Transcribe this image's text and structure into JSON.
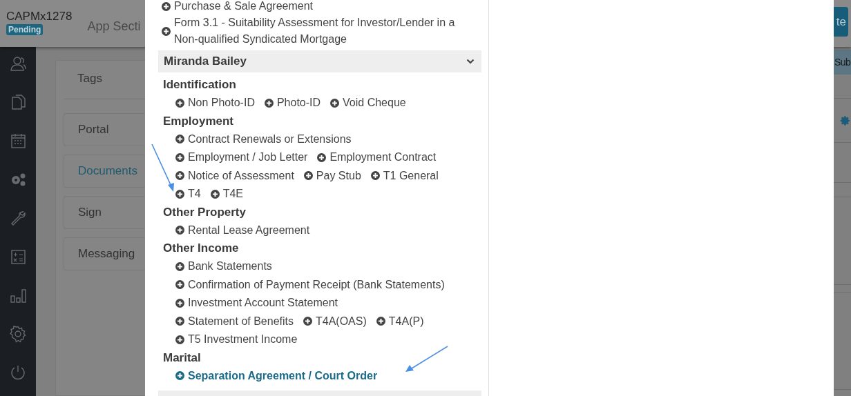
{
  "header": {
    "title": "CAPMx1278",
    "status_badge": "Pending",
    "section_label": "App Secti",
    "action_button": "te"
  },
  "tabs_panel": {
    "tab": "Tags",
    "items": [
      {
        "label": "Portal",
        "selected": false
      },
      {
        "label": "Documents",
        "selected": true
      },
      {
        "label": "Sign",
        "selected": false
      },
      {
        "label": "Messaging",
        "selected": false
      }
    ]
  },
  "right_panel": {
    "bar_label": "Sub"
  },
  "dialog": {
    "top_items": [
      {
        "label": "Purchase & Sale Agreement",
        "selected": false
      },
      {
        "label": "Form 3.1 - Suitability Assessment for Investor/Lender in a Non-qualified Syndicated Mortgage",
        "selected": false
      }
    ],
    "person": {
      "name": "Miranda Bailey",
      "expanded": true
    },
    "groups": [
      {
        "title": "Identification",
        "lines": [
          [
            {
              "label": "Non Photo-ID",
              "selected": false
            },
            {
              "label": "Photo-ID",
              "selected": false
            },
            {
              "label": "Void Cheque",
              "selected": false
            }
          ]
        ]
      },
      {
        "title": "Employment",
        "lines": [
          [
            {
              "label": "Contract Renewals or Extensions",
              "selected": false
            }
          ],
          [
            {
              "label": "Employment / Job Letter",
              "selected": false
            },
            {
              "label": "Employment Contract",
              "selected": false
            }
          ],
          [
            {
              "label": "Notice of Assessment",
              "selected": false
            },
            {
              "label": "Pay Stub",
              "selected": false
            },
            {
              "label": "T1 General",
              "selected": false
            }
          ],
          [
            {
              "label": "T4",
              "selected": false
            },
            {
              "label": "T4E",
              "selected": false
            }
          ]
        ]
      },
      {
        "title": "Other Property",
        "lines": [
          [
            {
              "label": "Rental Lease Agreement",
              "selected": false
            }
          ]
        ]
      },
      {
        "title": "Other Income",
        "lines": [
          [
            {
              "label": "Bank Statements",
              "selected": false
            }
          ],
          [
            {
              "label": "Confirmation of Payment Receipt (Bank Statements)",
              "selected": false
            }
          ],
          [
            {
              "label": "Investment Account Statement",
              "selected": false
            }
          ],
          [
            {
              "label": "Statement of Benefits",
              "selected": false
            },
            {
              "label": "T4A(OAS)",
              "selected": false
            },
            {
              "label": "T4A(P)",
              "selected": false
            }
          ],
          [
            {
              "label": "T5 Investment Income",
              "selected": false
            }
          ]
        ]
      },
      {
        "title": "Marital",
        "lines": [
          [
            {
              "label": "Separation Agreement / Court Order",
              "selected": true
            }
          ]
        ]
      }
    ]
  }
}
